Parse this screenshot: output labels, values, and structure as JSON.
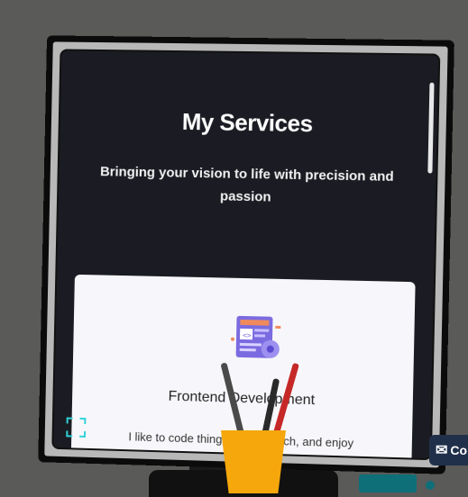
{
  "services": {
    "title": "My Services",
    "subtitle": "Bringing your vision to life with precision and passion",
    "cards": [
      {
        "title": "Frontend Development",
        "text": "I like to code things from scratch, and enjoy",
        "icon": "code-illustration-icon"
      }
    ]
  },
  "contact_button": {
    "icon": "envelope-icon",
    "label": "Co"
  },
  "colors": {
    "background": "#5a5a58",
    "screen": "#1b1c23",
    "card": "#f7f7fb",
    "accent_cup": "#f5a70c",
    "contact_bg": "#21304a",
    "focus_icon": "#2fd3d8"
  }
}
